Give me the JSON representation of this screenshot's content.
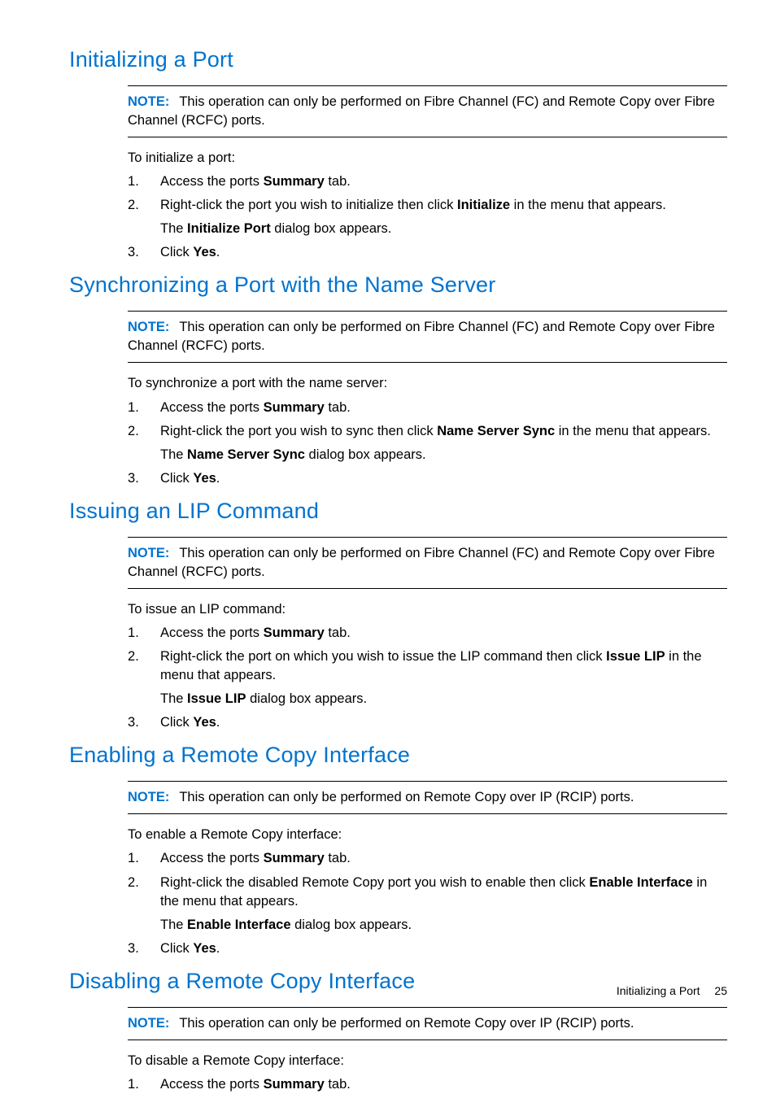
{
  "sections": [
    {
      "heading": "Initializing a Port",
      "note_label": "NOTE:",
      "note_text": "This operation can only be performed on Fibre Channel (FC) and Remote Copy over Fibre Channel (RCFC) ports.",
      "intro": "To initialize a port:",
      "steps": [
        {
          "pre": "Access the ports ",
          "bold": "Summary",
          "post": " tab."
        },
        {
          "pre": "Right-click the port you wish to initialize then click ",
          "bold": "Initialize",
          "post": " in the menu that appears.",
          "sub_pre": "The ",
          "sub_bold": "Initialize Port",
          "sub_post": " dialog box appears."
        },
        {
          "pre": "Click ",
          "bold": "Yes",
          "post": "."
        }
      ]
    },
    {
      "heading": "Synchronizing a Port with the Name Server",
      "note_label": "NOTE:",
      "note_text": "This operation can only be performed on Fibre Channel (FC) and Remote Copy over Fibre Channel (RCFC) ports.",
      "intro": "To synchronize a port with the name server:",
      "steps": [
        {
          "pre": "Access the ports ",
          "bold": "Summary",
          "post": " tab."
        },
        {
          "pre": "Right-click the port you wish to sync then click ",
          "bold": "Name Server Sync",
          "post": " in the menu that appears.",
          "sub_pre": "The ",
          "sub_bold": "Name Server Sync",
          "sub_post": " dialog box appears."
        },
        {
          "pre": "Click ",
          "bold": "Yes",
          "post": "."
        }
      ]
    },
    {
      "heading": "Issuing an LIP Command",
      "note_label": "NOTE:",
      "note_text": "This operation can only be performed on Fibre Channel (FC) and Remote Copy over Fibre Channel (RCFC) ports.",
      "intro": "To issue an LIP command:",
      "steps": [
        {
          "pre": "Access the ports ",
          "bold": "Summary",
          "post": " tab."
        },
        {
          "pre": "Right-click the port on which you wish to issue the LIP command then click ",
          "bold": "Issue LIP",
          "post": " in the menu that appears.",
          "sub_pre": "The ",
          "sub_bold": "Issue LIP",
          "sub_post": " dialog box appears."
        },
        {
          "pre": "Click ",
          "bold": "Yes",
          "post": "."
        }
      ]
    },
    {
      "heading": "Enabling a Remote Copy Interface",
      "note_label": "NOTE:",
      "note_text": "This operation can only be performed on Remote Copy over IP (RCIP) ports.",
      "intro": "To enable a Remote Copy interface:",
      "steps": [
        {
          "pre": "Access the ports ",
          "bold": "Summary",
          "post": " tab."
        },
        {
          "pre": "Right-click the disabled Remote Copy port you wish to enable then click ",
          "bold": "Enable Interface",
          "post": " in the menu that appears.",
          "sub_pre": "The ",
          "sub_bold": "Enable Interface",
          "sub_post": " dialog box appears."
        },
        {
          "pre": "Click ",
          "bold": "Yes",
          "post": "."
        }
      ]
    },
    {
      "heading": "Disabling a Remote Copy Interface",
      "note_label": "NOTE:",
      "note_text": "This operation can only be performed on Remote Copy over IP (RCIP) ports.",
      "intro": "To disable a Remote Copy interface:",
      "steps": [
        {
          "pre": "Access the ports ",
          "bold": "Summary",
          "post": " tab."
        }
      ]
    }
  ],
  "footer_text": "Initializing a Port",
  "footer_page": "25"
}
